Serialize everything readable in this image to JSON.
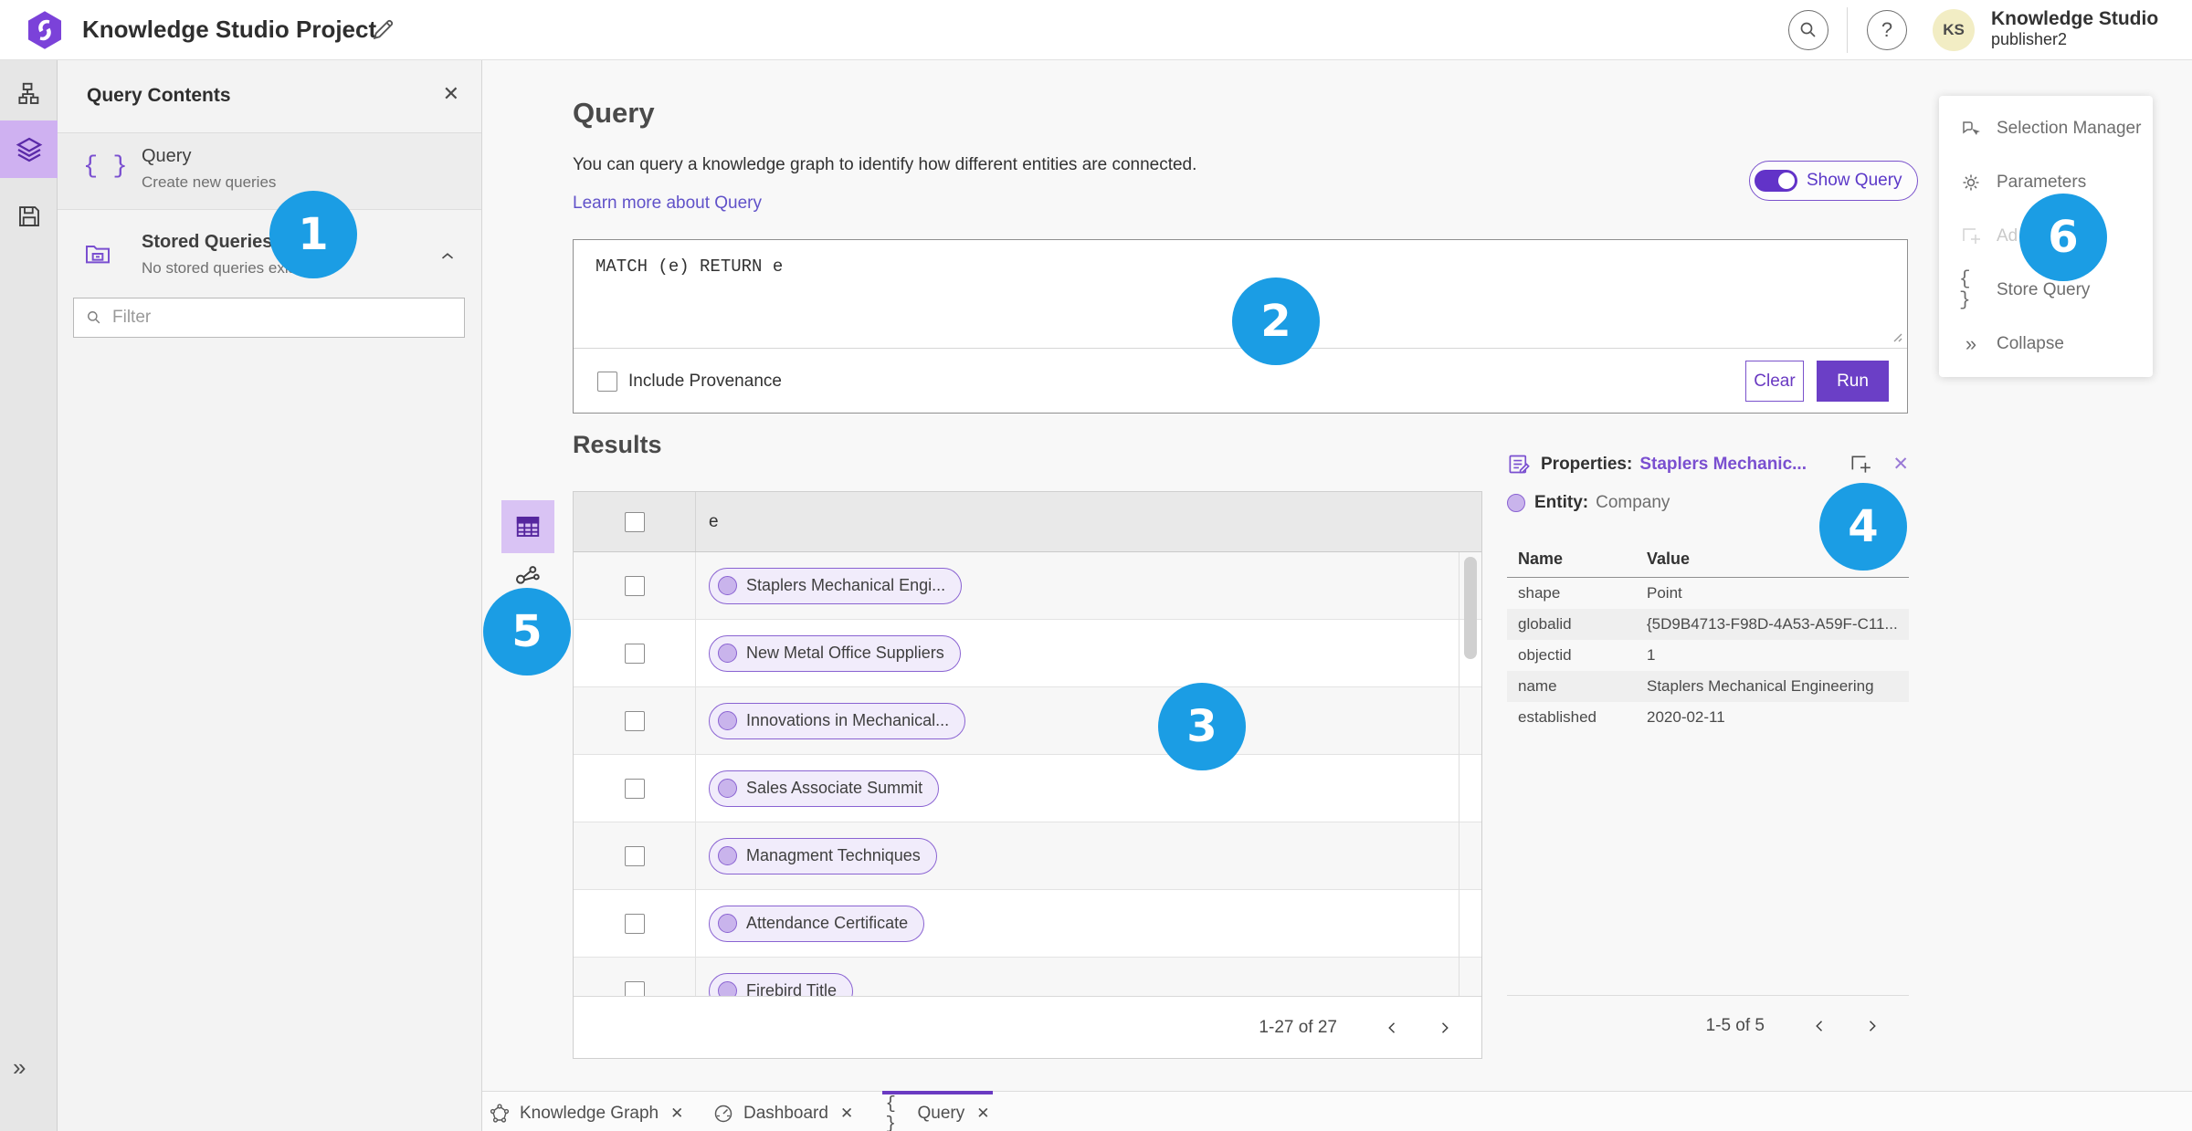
{
  "header": {
    "title": "Knowledge Studio Project",
    "product_name": "Knowledge Studio",
    "username": "publisher2",
    "avatar_initials": "KS"
  },
  "left_panel": {
    "title": "Query Contents",
    "query_item": {
      "title": "Query",
      "subtitle": "Create new queries"
    },
    "stored_item": {
      "title": "Stored Queries",
      "subtitle": "No stored queries exist"
    },
    "filter_placeholder": "Filter"
  },
  "query": {
    "heading": "Query",
    "description": "You can query a knowledge graph to identify how different entities are connected.",
    "learn_more": "Learn more about Query",
    "show_query_label": "Show Query",
    "code": "MATCH (e) RETURN e",
    "include_provenance_label": "Include Provenance",
    "clear_label": "Clear",
    "run_label": "Run"
  },
  "results": {
    "heading": "Results",
    "column_header": "e",
    "rows": [
      "Staplers Mechanical Engi...",
      "New Metal Office Suppliers",
      "Innovations in Mechanical...",
      "Sales Associate Summit",
      "Managment Techniques",
      "Attendance Certificate",
      "Firebird Title"
    ],
    "pagination": "1-27 of 27"
  },
  "properties": {
    "label": "Properties:",
    "entity_link": "Staplers Mechanic...",
    "entity_label": "Entity:",
    "entity_type": "Company",
    "col_name": "Name",
    "col_value": "Value",
    "rows": [
      {
        "name": "shape",
        "value": "Point"
      },
      {
        "name": "globalid",
        "value": "{5D9B4713-F98D-4A53-A59F-C11..."
      },
      {
        "name": "objectid",
        "value": "1"
      },
      {
        "name": "name",
        "value": "Staplers Mechanical Engineering"
      },
      {
        "name": "established",
        "value": "2020-02-11"
      }
    ],
    "pagination": "1-5 of 5"
  },
  "side_menu": {
    "items": [
      {
        "label": "Selection Manager",
        "icon": "selection-manager-icon",
        "disabled": false
      },
      {
        "label": "Parameters",
        "icon": "gear-icon",
        "disabled": false
      },
      {
        "label": "Ad",
        "icon": "add-square-icon",
        "disabled": true
      },
      {
        "label": "Store Query",
        "icon": "braces-icon",
        "disabled": false
      },
      {
        "label": "Collapse",
        "icon": "collapse-icon",
        "disabled": false
      }
    ]
  },
  "tabs": [
    {
      "label": "Knowledge Graph",
      "icon": "knowledge-graph-icon",
      "active": false
    },
    {
      "label": "Dashboard",
      "icon": "dashboard-icon",
      "active": false
    },
    {
      "label": "Query",
      "icon": "braces-icon",
      "active": true
    }
  ],
  "badges": [
    "1",
    "2",
    "3",
    "4",
    "5",
    "6"
  ],
  "colors": {
    "accent_purple": "#6a3ac2",
    "run_button": "#6b3fc6",
    "badge_blue": "#1b9de4",
    "pill_fill": "#f1ecfb",
    "pill_border": "#8a63d2",
    "rail_selected": "#cfb1f1",
    "avatar_bg": "#f2edc4"
  },
  "icons": {
    "app-logo": "purple-hexagon-swirl",
    "edit-pencil-icon": "pencil",
    "search-icon": "magnifier-in-circle",
    "help-icon": "question-mark-in-circle",
    "rail": [
      "data-model-icon",
      "layers-icon",
      "save-icon",
      "expand-icon"
    ],
    "view_toggles": [
      "table-view-icon",
      "link-chart-view-icon"
    ]
  }
}
